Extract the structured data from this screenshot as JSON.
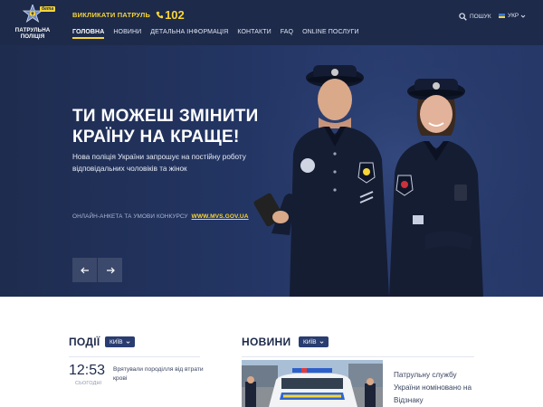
{
  "header": {
    "logo_text_line1": "ПАТРУЛЬНА",
    "logo_text_line2": "ПОЛІЦІЯ",
    "logo_badge": "бета",
    "call_label": "ВИКЛИКАТИ ПАТРУЛЬ",
    "call_number": "102",
    "search_label": "ПОШУК",
    "lang_label": "УКР",
    "nav": [
      {
        "label": "ГОЛОВНА",
        "active": true
      },
      {
        "label": "НОВИНИ"
      },
      {
        "label": "ДЕТАЛЬНА ІНФОРМАЦІЯ"
      },
      {
        "label": "КОНТАКТИ"
      },
      {
        "label": "FAQ"
      },
      {
        "label": "ONLINE ПОСЛУГИ"
      }
    ]
  },
  "hero": {
    "title_line1": "ТИ МОЖЕШ ЗМІНИТИ",
    "title_line2": "КРАЇНУ НА КРАЩЕ!",
    "subtitle": "Нова поліція України запрошує на постійну роботу відповідальних чоловіків та жінок",
    "cta_text": "ОНЛАЙН-АНКЕТА ТА УМОВИ КОНКУРСУ",
    "cta_link": "WWW.MVS.GOV.UA"
  },
  "events": {
    "title": "ПОДІЇ",
    "city": "КИЇВ",
    "item_time": "12:53",
    "item_day": "СЬОГОДНІ",
    "item_text": "Врятували породілля від втрати крові"
  },
  "news": {
    "title": "НОВИНИ",
    "city": "КИЇВ",
    "item_text": "Патрульну службу України номіновано на Відзнаку"
  },
  "colors": {
    "header_bg": "#1d2a4a",
    "accent_yellow": "#f7d538",
    "hero_bg": "#233563",
    "city_pill": "#2a3d70"
  },
  "icons": [
    "star-logo-icon",
    "phone-icon",
    "search-icon",
    "ukraine-flag-icon",
    "chevron-down-icon",
    "arrow-left-icon",
    "arrow-right-icon"
  ]
}
